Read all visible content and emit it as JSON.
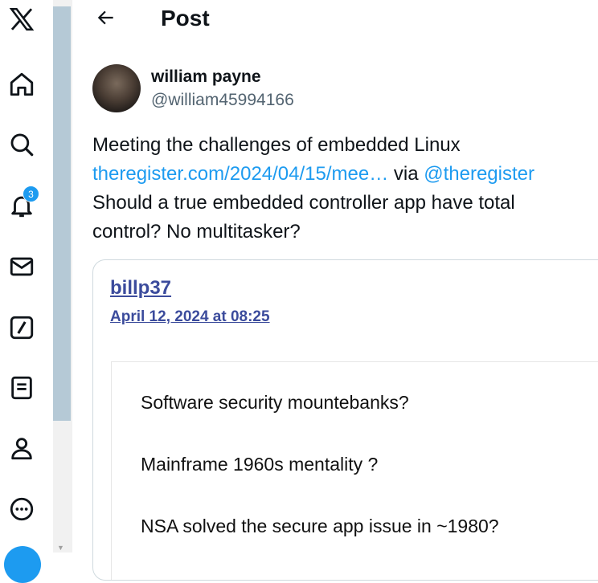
{
  "header": {
    "title": "Post"
  },
  "notifications": {
    "count": "3"
  },
  "post": {
    "author_name": "william payne",
    "author_handle": "@william45994166",
    "line1": "Meeting the challenges of embedded Linux",
    "link_text": "theregister.com/2024/04/15/mee…",
    "via_text": " via ",
    "mention": "@theregister",
    "line3": "Should a true embedded controller app have total",
    "line4": "control?  No multitasker?"
  },
  "card": {
    "author": "billp37",
    "date": "April 12, 2024 at 08:25",
    "lines": [
      "Software security mountebanks?",
      "Mainframe 1960s mentality ?",
      "NSA solved the secure app issue in ~1980?"
    ]
  }
}
